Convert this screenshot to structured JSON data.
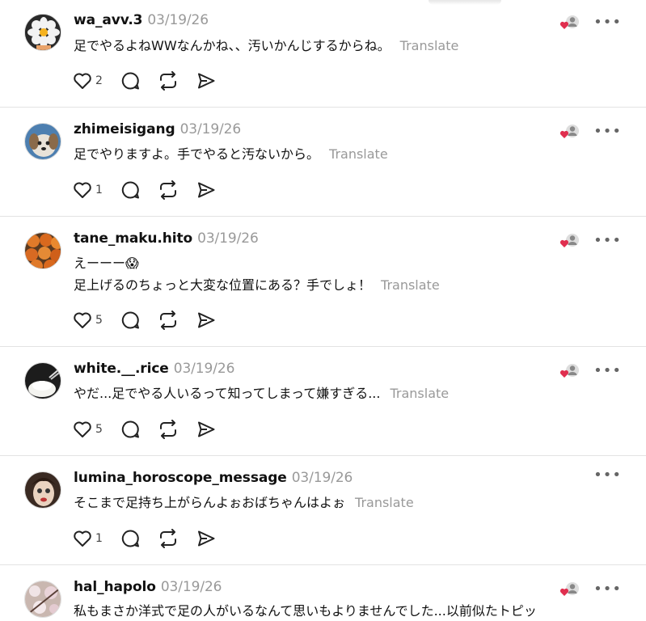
{
  "translate_label": "Translate",
  "colors": {
    "heart": "#e02f4f",
    "muted": "#999999"
  },
  "posts": [
    {
      "username": "wa_avv.3",
      "date": "03/19/26",
      "lines": [
        "足でやるよねWWなんかね、、汚いかんじするからね。"
      ],
      "likes": "2",
      "liked_by_author": true
    },
    {
      "username": "zhimeisigang",
      "date": "03/19/26",
      "lines": [
        "足でやりますよ。手でやると汚ないから。"
      ],
      "likes": "1",
      "liked_by_author": true
    },
    {
      "username": "tane_maku.hito",
      "date": "03/19/26",
      "lines": [
        "えーーー😱",
        "足上げるのちょっと大変な位置にある？手でしょ！"
      ],
      "likes": "5",
      "liked_by_author": true
    },
    {
      "username": "white.__.rice",
      "date": "03/19/26",
      "lines": [
        "やだ...足でやる人いるって知ってしまって嫌すぎる..."
      ],
      "likes": "5",
      "liked_by_author": true
    },
    {
      "username": "lumina_horoscope_message",
      "date": "03/19/26",
      "lines": [
        "そこまで足持ち上がらんよぉおばちゃんはよぉ"
      ],
      "likes": "1",
      "liked_by_author": false
    },
    {
      "username": "hal_hapolo",
      "date": "03/19/26",
      "lines": [
        "私もまさか洋式で足の人がいるなんて思いもよりませんでした...以前似たトピッ"
      ],
      "likes": "",
      "liked_by_author": true
    }
  ]
}
